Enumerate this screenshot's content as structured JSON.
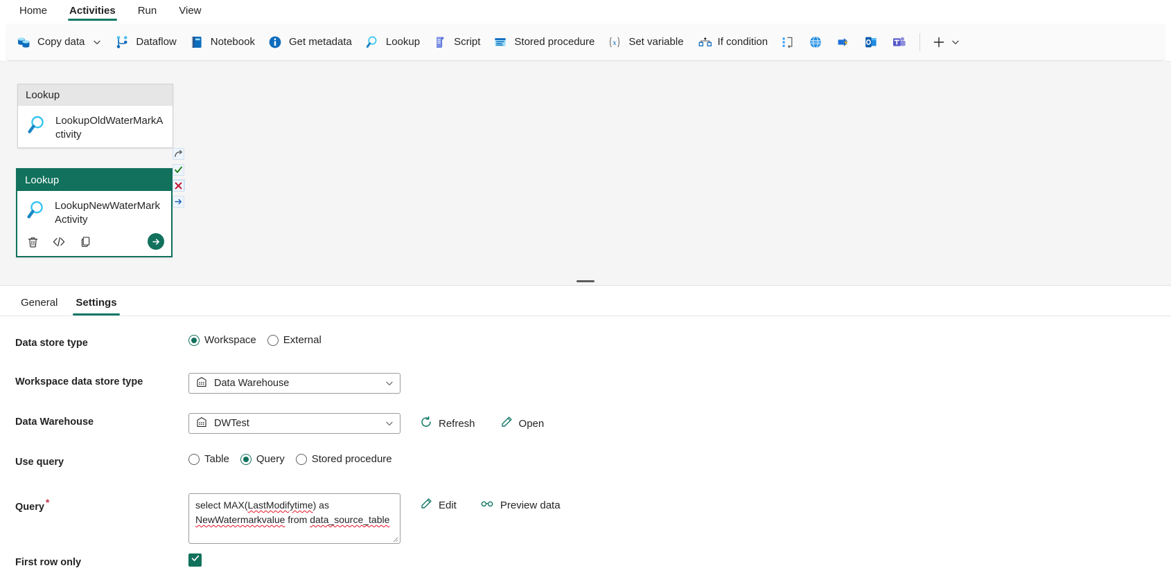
{
  "ribbon": {
    "tabs": [
      {
        "label": "Home",
        "active": false
      },
      {
        "label": "Activities",
        "active": true
      },
      {
        "label": "Run",
        "active": false
      },
      {
        "label": "View",
        "active": false
      }
    ]
  },
  "toolbar": {
    "items": [
      {
        "label": "Copy data",
        "icon": "copy-data-icon",
        "caret": true
      },
      {
        "label": "Dataflow",
        "icon": "dataflow-icon",
        "caret": false
      },
      {
        "label": "Notebook",
        "icon": "notebook-icon",
        "caret": false
      },
      {
        "label": "Get metadata",
        "icon": "info-icon",
        "caret": false
      },
      {
        "label": "Lookup",
        "icon": "magnifier-icon",
        "caret": false
      },
      {
        "label": "Script",
        "icon": "script-icon",
        "caret": false
      },
      {
        "label": "Stored procedure",
        "icon": "stored-procedure-icon",
        "caret": false
      },
      {
        "label": "Set variable",
        "icon": "set-variable-icon",
        "caret": false
      },
      {
        "label": "If condition",
        "icon": "if-condition-icon",
        "caret": false
      }
    ],
    "icon_only": [
      {
        "name": "switch-icon"
      },
      {
        "name": "web-globe-icon"
      },
      {
        "name": "azure-function-icon"
      },
      {
        "name": "outlook-icon"
      },
      {
        "name": "teams-icon"
      }
    ],
    "add_label": "",
    "add_icon": "plus-icon",
    "add_caret_icon": "chevron-down-icon"
  },
  "canvas": {
    "activities": [
      {
        "type": "Lookup",
        "name": "LookupOldWaterMarkActivity",
        "selected": false,
        "icon": "magnifier-icon",
        "status": [
          "success-check"
        ]
      },
      {
        "type": "Lookup",
        "name": "LookupNewWaterMarkActivity",
        "selected": true,
        "icon": "magnifier-icon",
        "status": [
          "skip-arrow",
          "success-check",
          "failure-x",
          "completion-arrow"
        ],
        "actions": [
          {
            "name": "delete-activity",
            "icon": "trash-icon"
          },
          {
            "name": "view-code",
            "icon": "code-icon"
          },
          {
            "name": "clone-activity",
            "icon": "copy-icon"
          },
          {
            "name": "run-activity",
            "icon": "arrow-right-icon"
          }
        ]
      }
    ]
  },
  "properties": {
    "tabs": [
      {
        "label": "General",
        "active": false
      },
      {
        "label": "Settings",
        "active": true
      }
    ],
    "fields": {
      "data_store_type": {
        "label": "Data store type",
        "options": [
          {
            "label": "Workspace",
            "selected": true
          },
          {
            "label": "External",
            "selected": false
          }
        ]
      },
      "workspace_data_store_type": {
        "label": "Workspace data store type",
        "value": "Data Warehouse",
        "icon": "warehouse-icon"
      },
      "data_warehouse": {
        "label": "Data Warehouse",
        "value": "DWTest",
        "icon": "warehouse-icon",
        "refresh_label": "Refresh",
        "refresh_icon": "refresh-icon",
        "open_label": "Open",
        "open_icon": "pencil-icon"
      },
      "use_query": {
        "label": "Use query",
        "options": [
          {
            "label": "Table",
            "selected": false
          },
          {
            "label": "Query",
            "selected": true
          },
          {
            "label": "Stored procedure",
            "selected": false
          }
        ]
      },
      "query": {
        "label": "Query",
        "required": true,
        "value_parts": [
          {
            "text": "select MAX(",
            "spell": false
          },
          {
            "text": "LastModifytime",
            "spell": true
          },
          {
            "text": ") as ",
            "spell": false
          },
          {
            "text": "NewWatermarkvalue",
            "spell": true
          },
          {
            "text": " from ",
            "spell": false
          },
          {
            "text": "data_source_table",
            "spell": true
          }
        ],
        "value": "select MAX(LastModifytime) as NewWatermarkvalue from data_source_table",
        "edit_label": "Edit",
        "edit_icon": "pencil-icon",
        "preview_label": "Preview data",
        "preview_icon": "glasses-icon"
      },
      "first_row_only": {
        "label": "First row only",
        "checked": true,
        "icon": "checkmark-icon"
      }
    }
  },
  "colors": {
    "accent_green": "#117865",
    "header_green": "#11715c",
    "required_red": "#c4314b",
    "icon_blue": "#0078d4",
    "canvas_bg": "#f5f5f5"
  }
}
